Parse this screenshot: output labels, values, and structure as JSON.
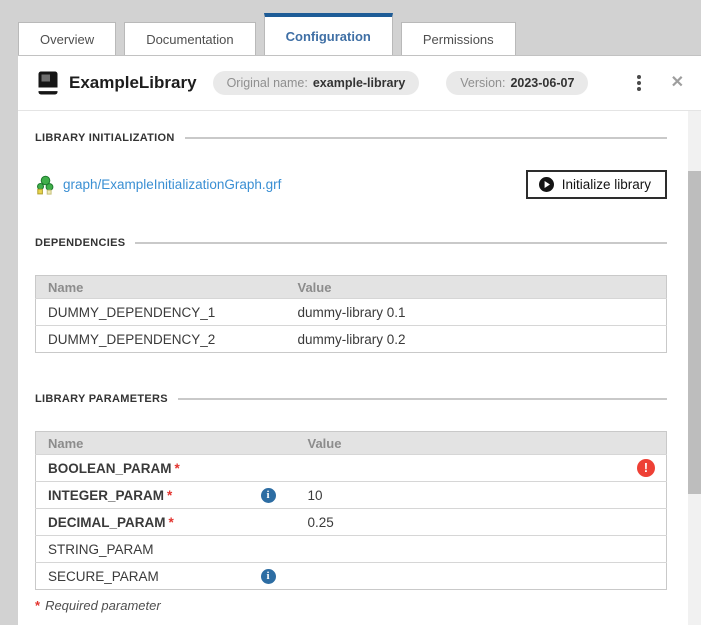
{
  "tabs": [
    {
      "label": "Overview",
      "active": false
    },
    {
      "label": "Documentation",
      "active": false
    },
    {
      "label": "Configuration",
      "active": true
    },
    {
      "label": "Permissions",
      "active": false
    }
  ],
  "header": {
    "title": "ExampleLibrary",
    "badges": [
      {
        "label": "Original name:",
        "value": "example-library"
      },
      {
        "label": "Version:",
        "value": "2023-06-07"
      }
    ]
  },
  "library_initialization": {
    "section_title": "LIBRARY INITIALIZATION",
    "graph_link": "graph/ExampleInitializationGraph.grf",
    "button_label": "Initialize library"
  },
  "dependencies": {
    "section_title": "DEPENDENCIES",
    "columns": [
      "Name",
      "Value"
    ],
    "rows": [
      {
        "name": "DUMMY_DEPENDENCY_1",
        "value": "dummy-library 0.1"
      },
      {
        "name": "DUMMY_DEPENDENCY_2",
        "value": "dummy-library 0.2"
      }
    ]
  },
  "library_parameters": {
    "section_title": "LIBRARY PARAMETERS",
    "columns": [
      "Name",
      "Value"
    ],
    "rows": [
      {
        "name": "BOOLEAN_PARAM",
        "required": true,
        "info": false,
        "value": "",
        "error": true
      },
      {
        "name": "INTEGER_PARAM",
        "required": true,
        "info": true,
        "value": "10",
        "error": false
      },
      {
        "name": "DECIMAL_PARAM",
        "required": true,
        "info": false,
        "value": "0.25",
        "error": false
      },
      {
        "name": "STRING_PARAM",
        "required": false,
        "info": false,
        "value": "",
        "error": false
      },
      {
        "name": "SECURE_PARAM",
        "required": false,
        "info": true,
        "value": "",
        "error": false
      }
    ],
    "footnote": {
      "marker": "*",
      "text": "Required parameter"
    }
  },
  "colors": {
    "accent_blue": "#1e5c97",
    "active_tab_text": "#3f6fa5",
    "link_blue": "#3a8fd3",
    "info_blue": "#2d6da3",
    "error_red": "#ee4035",
    "required_red": "#e3342f",
    "page_background": "#d2d2d2"
  }
}
